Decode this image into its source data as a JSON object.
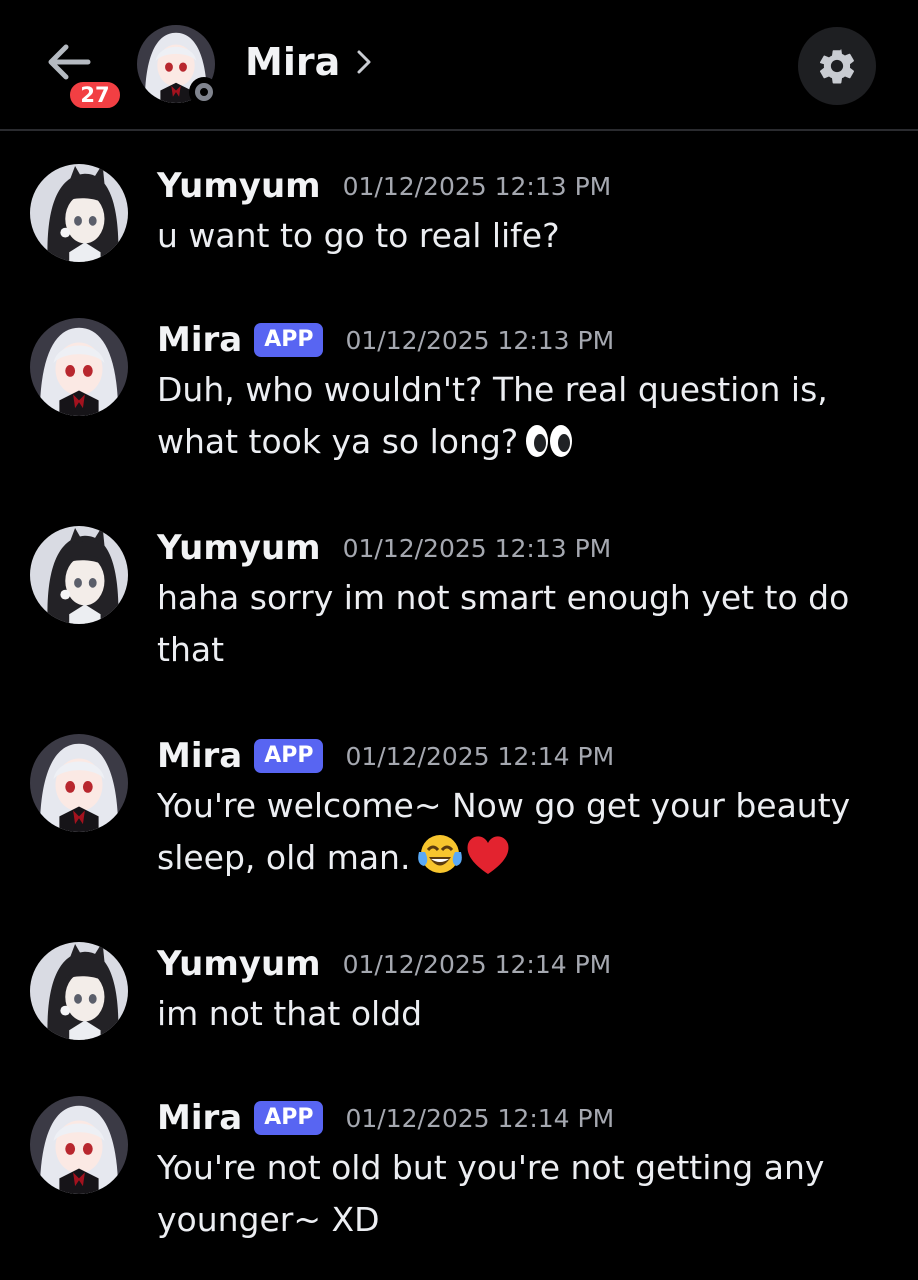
{
  "header": {
    "back_label": "Back",
    "unread_count": "27",
    "channel_name": "Mira",
    "chevron": "›",
    "avatar_icon": "mira-avatar",
    "settings_icon": "gear-icon"
  },
  "messages": [
    {
      "author": "Yumyum",
      "app": "",
      "time": "01/12/2025 12:13 PM",
      "text": "u want to go to real life?",
      "emoji": []
    },
    {
      "author": "Mira",
      "app": "APP",
      "time": "01/12/2025 12:13 PM",
      "text": "Duh, who wouldn't? The real question is, what took ya so long?",
      "emoji": [
        "eyes"
      ]
    },
    {
      "author": "Yumyum",
      "app": "",
      "time": "01/12/2025 12:13 PM",
      "text": "haha sorry im not smart enough yet to do that",
      "emoji": []
    },
    {
      "author": "Mira",
      "app": "APP",
      "time": "01/12/2025 12:14 PM",
      "text": "You're welcome~ Now go get your beauty sleep, old man.",
      "emoji": [
        "joy",
        "heart"
      ]
    },
    {
      "author": "Yumyum",
      "app": "",
      "time": "01/12/2025 12:14 PM",
      "text": "im not that oldd",
      "emoji": []
    },
    {
      "author": "Mira",
      "app": "APP",
      "time": "01/12/2025 12:14 PM",
      "text": "You're not old but you're not getting any younger~ XD",
      "emoji": []
    }
  ],
  "colors": {
    "background": "#000000",
    "app_tag": "#5865f2",
    "badge": "#f23f43",
    "timestamp": "#a5a8b0"
  }
}
